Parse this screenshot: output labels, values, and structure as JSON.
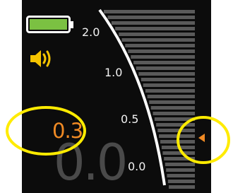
{
  "status": {
    "battery_icon": "battery-full-icon",
    "battery_level": 1.0,
    "battery_color": "#7bc142",
    "volume_icon": "speaker-volume-icon",
    "volume_color": "#f5c400"
  },
  "scale": {
    "labels": [
      "2.0",
      "1.0",
      "0.5",
      "0.0"
    ],
    "pointer_icon": "left-pointer-triangle-icon",
    "pointer_color": "#f08a24",
    "pointer_value": "0.3"
  },
  "readout": {
    "current_value": "0.3",
    "current_color": "#f08a24",
    "large_value": "0.0",
    "large_color": "#4a4a4a"
  },
  "annotations": {
    "highlight_color": "#ffeb00"
  }
}
